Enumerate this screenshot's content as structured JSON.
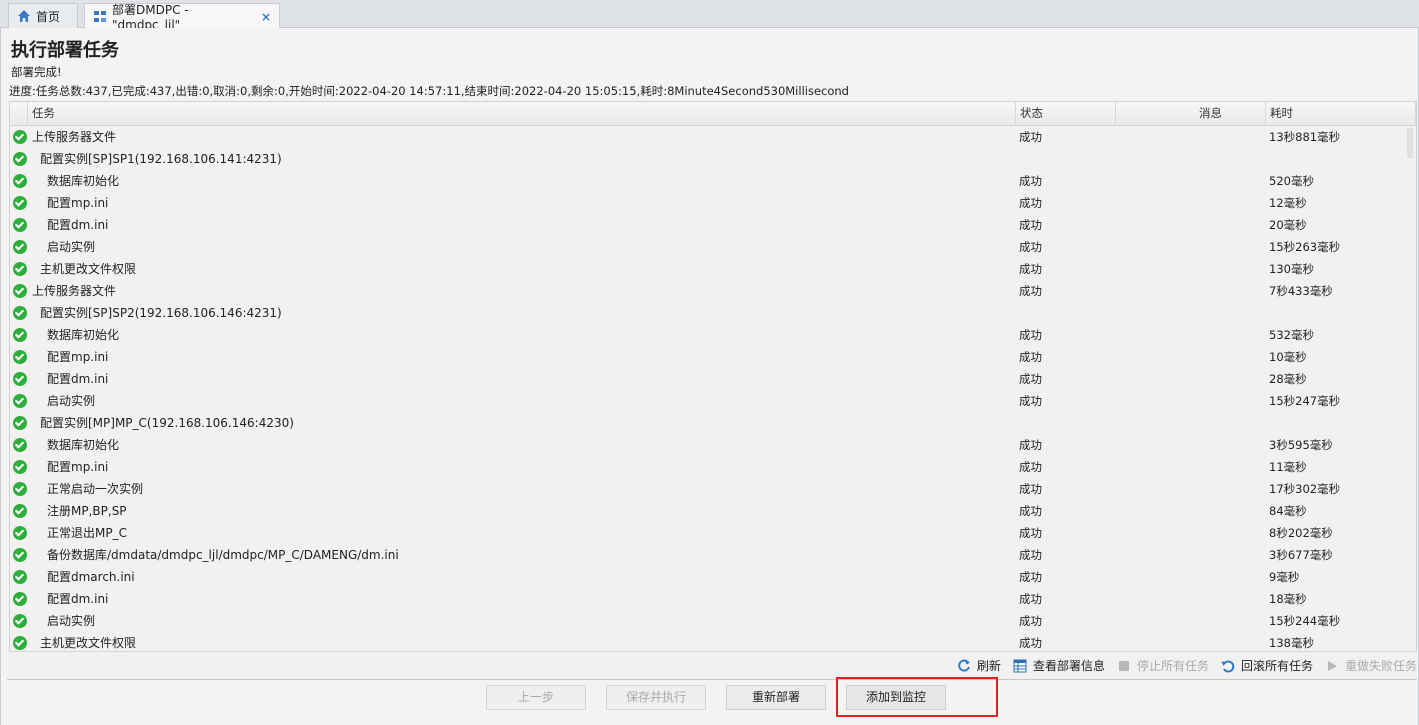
{
  "tabs": [
    {
      "label": "首页",
      "icon": "home-icon"
    },
    {
      "label": "部署DMDPC - \"dmdpc_ljl\"",
      "icon": "deploy-icon",
      "close": "×"
    }
  ],
  "page": {
    "title": "执行部署任务",
    "status": "部署完成!",
    "progress": "进度:任务总数:437,已完成:437,出错:0,取消:0,剩余:0,开始时间:2022-04-20 14:57:11,结束时间:2022-04-20 15:05:15,耗时:8Minute4Second530Millisecond"
  },
  "grid": {
    "headers": {
      "task": "任务",
      "status": "状态",
      "message": "消息",
      "time": "耗时"
    },
    "rows": [
      {
        "level": 0,
        "task": "上传服务器文件",
        "status": "成功",
        "time": "13秒881毫秒"
      },
      {
        "level": 1,
        "task": "配置实例[SP]SP1(192.168.106.141:4231)",
        "status": "",
        "time": ""
      },
      {
        "level": 2,
        "task": "数据库初始化",
        "status": "成功",
        "time": "520毫秒"
      },
      {
        "level": 2,
        "task": "配置mp.ini",
        "status": "成功",
        "time": "12毫秒"
      },
      {
        "level": 2,
        "task": "配置dm.ini",
        "status": "成功",
        "time": "20毫秒"
      },
      {
        "level": 2,
        "task": "启动实例",
        "status": "成功",
        "time": "15秒263毫秒"
      },
      {
        "level": 1,
        "task": "主机更改文件权限",
        "status": "成功",
        "time": "130毫秒"
      },
      {
        "level": 0,
        "task": "上传服务器文件",
        "status": "成功",
        "time": "7秒433毫秒"
      },
      {
        "level": 1,
        "task": "配置实例[SP]SP2(192.168.106.146:4231)",
        "status": "",
        "time": ""
      },
      {
        "level": 2,
        "task": "数据库初始化",
        "status": "成功",
        "time": "532毫秒"
      },
      {
        "level": 2,
        "task": "配置mp.ini",
        "status": "成功",
        "time": "10毫秒"
      },
      {
        "level": 2,
        "task": "配置dm.ini",
        "status": "成功",
        "time": "28毫秒"
      },
      {
        "level": 2,
        "task": "启动实例",
        "status": "成功",
        "time": "15秒247毫秒"
      },
      {
        "level": 1,
        "task": "配置实例[MP]MP_C(192.168.106.146:4230)",
        "status": "",
        "time": ""
      },
      {
        "level": 2,
        "task": "数据库初始化",
        "status": "成功",
        "time": "3秒595毫秒"
      },
      {
        "level": 2,
        "task": "配置mp.ini",
        "status": "成功",
        "time": "11毫秒"
      },
      {
        "level": 2,
        "task": "正常启动一次实例",
        "status": "成功",
        "time": "17秒302毫秒"
      },
      {
        "level": 2,
        "task": "注册MP,BP,SP",
        "status": "成功",
        "time": "84毫秒"
      },
      {
        "level": 2,
        "task": "正常退出MP_C",
        "status": "成功",
        "time": "8秒202毫秒"
      },
      {
        "level": 2,
        "task": "备份数据库/dmdata/dmdpc_ljl/dmdpc/MP_C/DAMENG/dm.ini",
        "status": "成功",
        "time": "3秒677毫秒"
      },
      {
        "level": 2,
        "task": "配置dmarch.ini",
        "status": "成功",
        "time": "9毫秒"
      },
      {
        "level": 2,
        "task": "配置dm.ini",
        "status": "成功",
        "time": "18毫秒"
      },
      {
        "level": 2,
        "task": "启动实例",
        "status": "成功",
        "time": "15秒244毫秒"
      },
      {
        "level": 1,
        "task": "主机更改文件权限",
        "status": "成功",
        "time": "138毫秒"
      }
    ]
  },
  "toolbar": {
    "refresh": "刷新",
    "view_info": "查看部署信息",
    "stop_all": "停止所有任务",
    "rollback_all": "回滚所有任务",
    "redo_failed": "重做失败任务"
  },
  "buttons": {
    "prev": "上一步",
    "save_exec": "保存并执行",
    "redeploy": "重新部署",
    "add_monitor": "添加到监控"
  },
  "colors": {
    "success": "#2eae3d",
    "accent": "#3a78c3",
    "highlight": "#e02020"
  }
}
